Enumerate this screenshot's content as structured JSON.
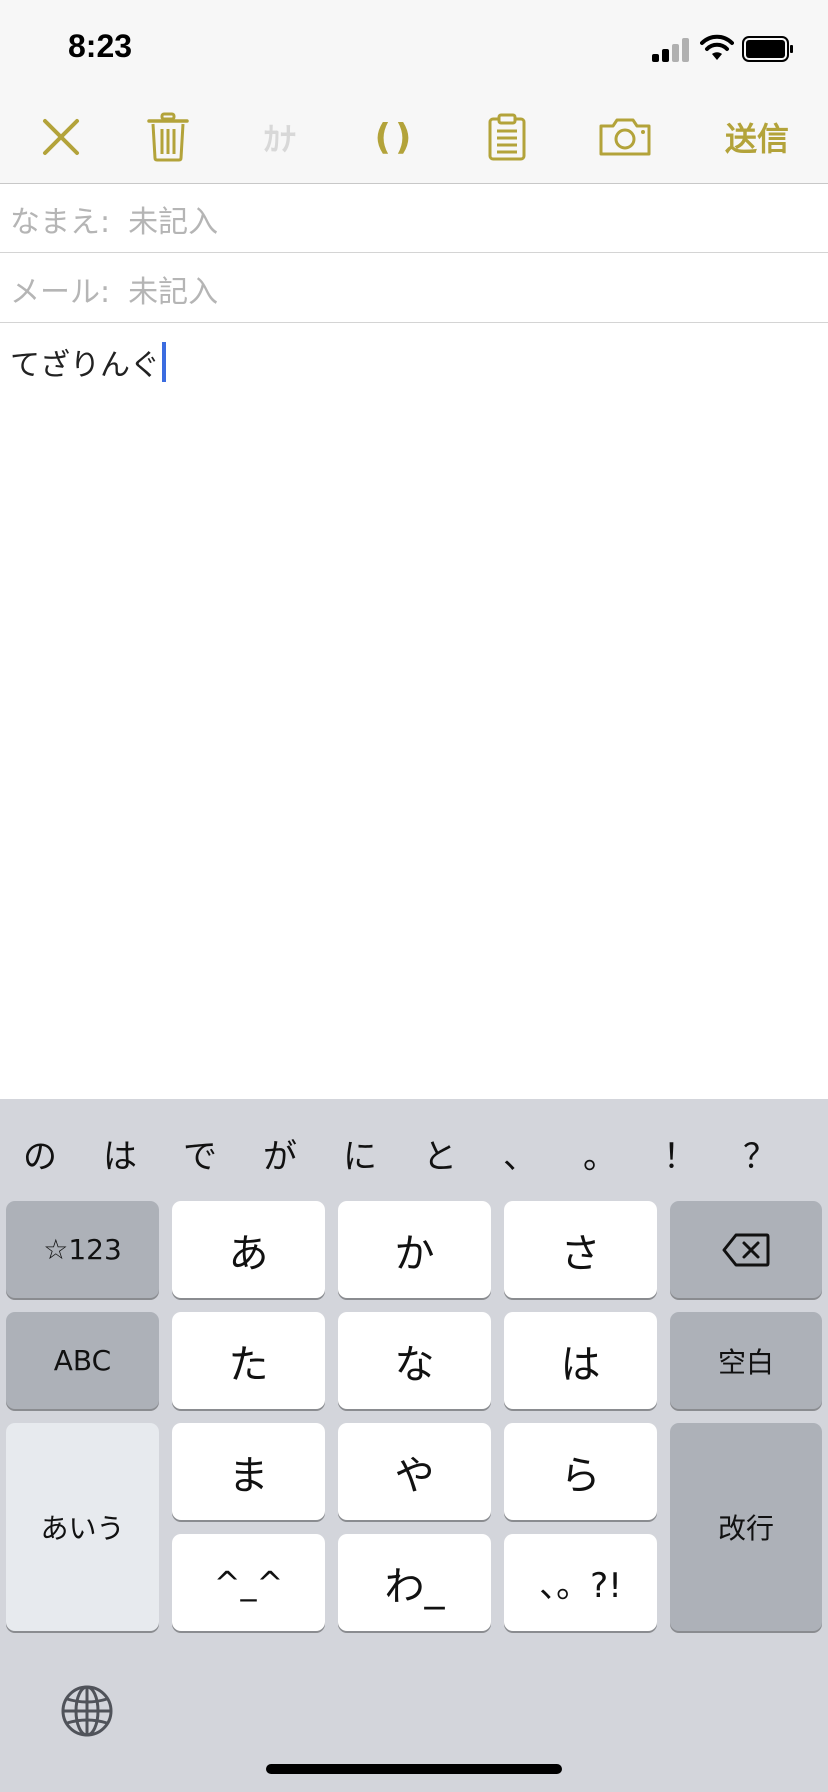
{
  "status": {
    "time": "8:23"
  },
  "toolbar": {
    "kana_label": "ｶﾅ",
    "paren_label": "()",
    "send_label": "送信"
  },
  "form": {
    "name_label": "なまえ:",
    "name_placeholder": "未記入",
    "mail_label": "メール:",
    "mail_placeholder": "未記入",
    "body_text": "てざりんぐ"
  },
  "keyboard": {
    "candidates": [
      "の",
      "は",
      "で",
      "が",
      "に",
      "と",
      "、",
      "。",
      "！",
      "？"
    ],
    "keys": {
      "symbols": "☆123",
      "a": "あ",
      "ka": "か",
      "sa": "さ",
      "abc": "ABC",
      "ta": "た",
      "na": "な",
      "ha": "は",
      "space": "空白",
      "kana_mode": "あいう",
      "ma": "ま",
      "ya": "や",
      "ra": "ら",
      "return": "改行",
      "emoticon": "^_^",
      "wa": "わ_",
      "punct": "、。?!"
    }
  },
  "colors": {
    "accent": "#b3a33a",
    "cursor": "#3b6ce0",
    "keyboard_bg": "#d3d5db"
  }
}
